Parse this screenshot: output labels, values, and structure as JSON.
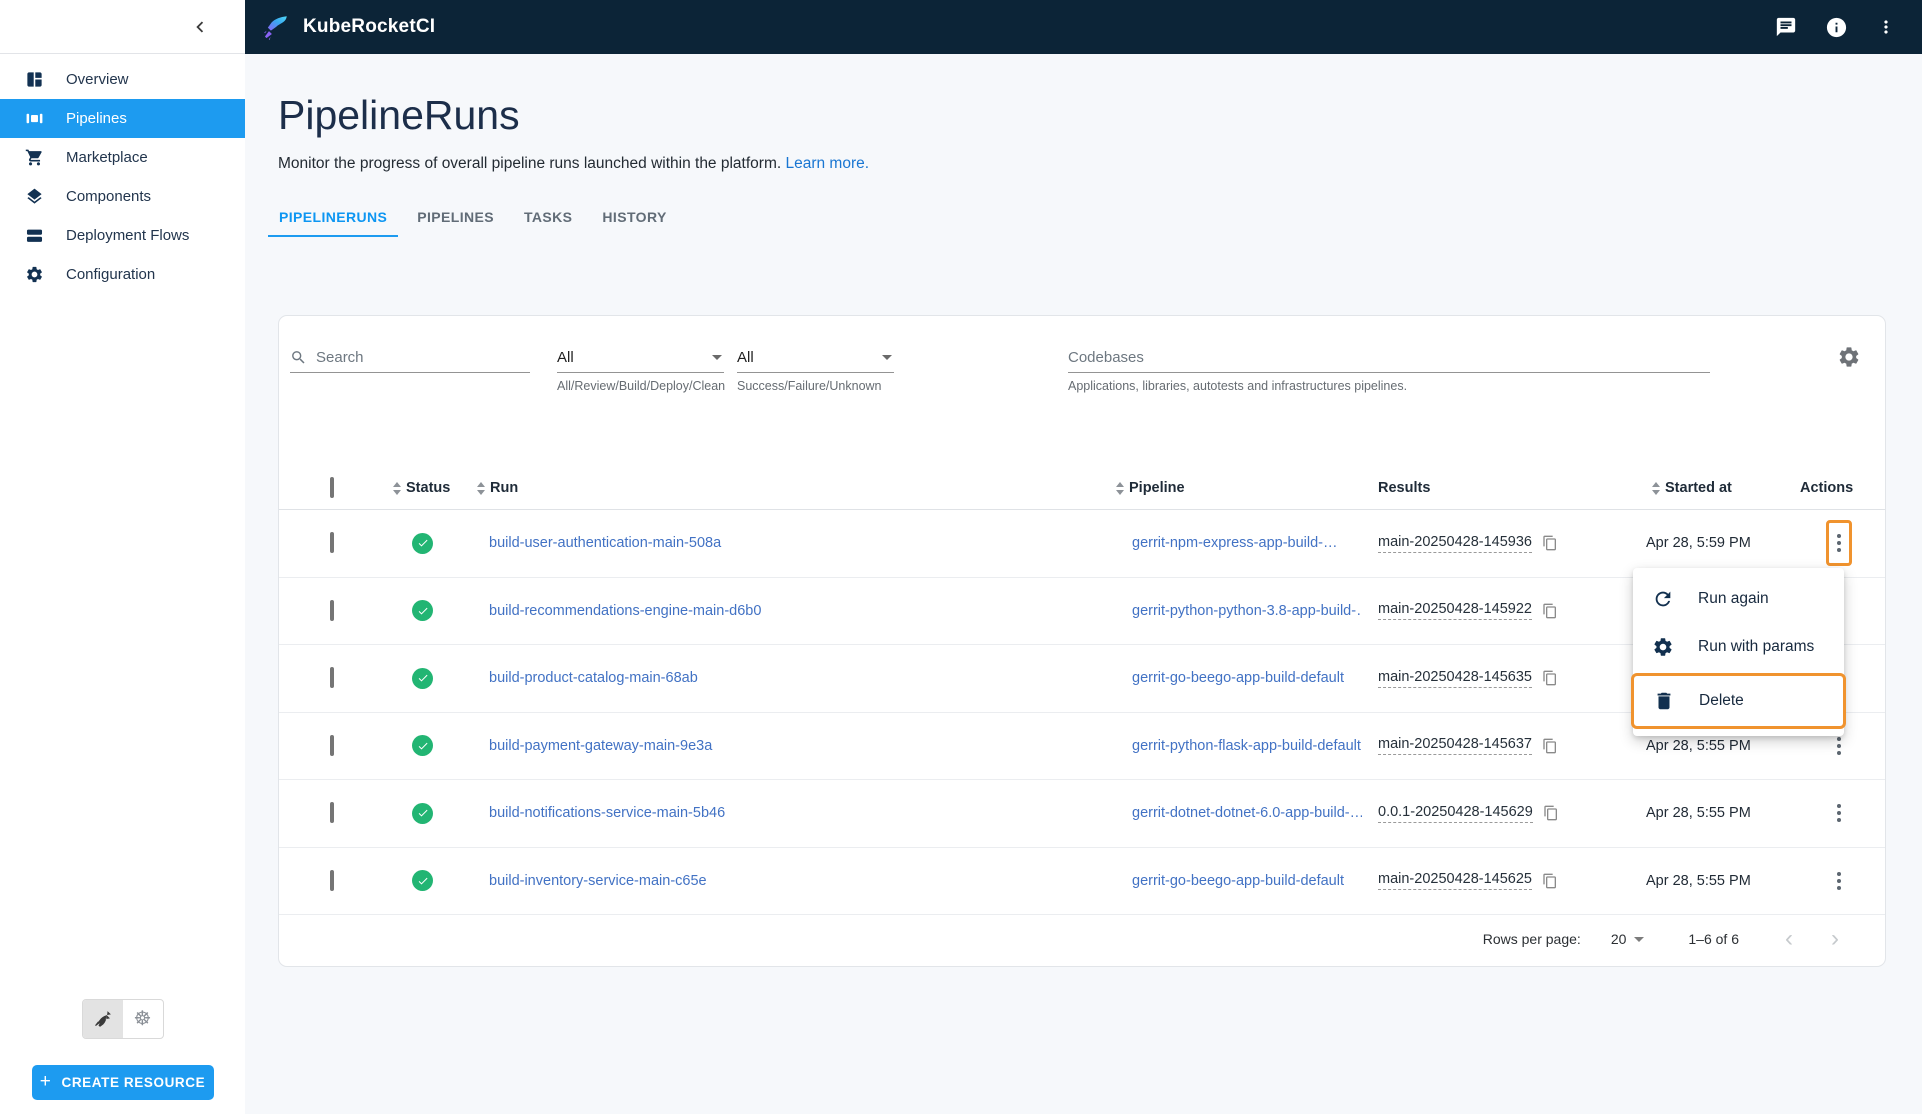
{
  "colors": {
    "topbar_bg": "#0c2437",
    "primary_blue": "#1d9bf0",
    "link_blue": "#4272c4",
    "success_green": "#22b573",
    "highlight_orange": "#f0932e"
  },
  "topbar": {
    "app_title": "KubeRocketCI"
  },
  "sidebar": {
    "items": [
      {
        "label": "Overview"
      },
      {
        "label": "Pipelines"
      },
      {
        "label": "Marketplace"
      },
      {
        "label": "Components"
      },
      {
        "label": "Deployment Flows"
      },
      {
        "label": "Configuration"
      }
    ],
    "create_button_label": "CREATE RESOURCE"
  },
  "page": {
    "title": "PipelineRuns",
    "description": "Monitor the progress of overall pipeline runs launched within the platform.",
    "learn_more_label": "Learn more.",
    "tabs": [
      {
        "label": "PIPELINERUNS"
      },
      {
        "label": "PIPELINES"
      },
      {
        "label": "TASKS"
      },
      {
        "label": "HISTORY"
      }
    ]
  },
  "filters": {
    "search_placeholder": "Search",
    "pipeline_type": {
      "value": "All",
      "helper": "All/Review/Build/Deploy/Clean"
    },
    "status": {
      "value": "All",
      "helper": "Success/Failure/Unknown"
    },
    "codebases": {
      "placeholder": "Codebases",
      "helper": "Applications, libraries, autotests and infrastructures pipelines."
    }
  },
  "table": {
    "headers": {
      "status": "Status",
      "run": "Run",
      "pipeline": "Pipeline",
      "results": "Results",
      "started": "Started at",
      "actions": "Actions"
    },
    "rows": [
      {
        "run": "build-user-authentication-main-508a",
        "pipeline": "gerrit-npm-express-app-build-…",
        "result": "main-20250428-145936",
        "started": "Apr 28, 5:59 PM"
      },
      {
        "run": "build-recommendations-engine-main-d6b0",
        "pipeline": "gerrit-python-python-3.8-app-build-…",
        "result": "main-20250428-145922",
        "started": ""
      },
      {
        "run": "build-product-catalog-main-68ab",
        "pipeline": "gerrit-go-beego-app-build-default",
        "result": "main-20250428-145635",
        "started": ""
      },
      {
        "run": "build-payment-gateway-main-9e3a",
        "pipeline": "gerrit-python-flask-app-build-default",
        "result": "main-20250428-145637",
        "started": "Apr 28, 5:55 PM"
      },
      {
        "run": "build-notifications-service-main-5b46",
        "pipeline": "gerrit-dotnet-dotnet-6.0-app-build-…",
        "result": "0.0.1-20250428-145629",
        "started": "Apr 28, 5:55 PM"
      },
      {
        "run": "build-inventory-service-main-c65e",
        "pipeline": "gerrit-go-beego-app-build-default",
        "result": "main-20250428-145625",
        "started": "Apr 28, 5:55 PM"
      }
    ]
  },
  "context_menu": {
    "items": [
      {
        "label": "Run again"
      },
      {
        "label": "Run with params"
      },
      {
        "label": "Delete"
      }
    ]
  },
  "pagination": {
    "rows_per_page_label": "Rows per page:",
    "rows_per_page_value": "20",
    "range_label": "1–6 of 6"
  }
}
